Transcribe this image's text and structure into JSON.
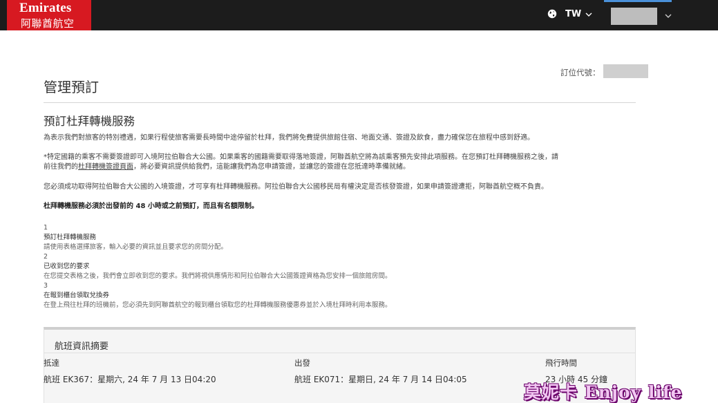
{
  "header": {
    "logo_en": "Emirates",
    "logo_zh": "阿聯酋航空",
    "region": "TW",
    "brand_color": "#d71921",
    "bar_color": "#1c1c1c",
    "accent_color": "#4a90d9"
  },
  "booking": {
    "ref_label": "訂位代號："
  },
  "page": {
    "title": "管理預訂",
    "section_title": "預訂杜拜轉機服務",
    "para1": "為表示我們對旅客的特別禮遇，如果行程使旅客需要長時間中途停留於杜拜，我們將免費提供旅館住宿、地面交通、簽證及飲食，盡力確保您在旅程中感到舒適。",
    "para2a": "*特定國籍的乘客不需要簽證即可入境阿拉伯聯合大公國。如果乘客的國籍需要取得落地簽證，阿聯酋航空將為該乘客預先安排此項服務。在您預訂杜拜轉機服務之後，請",
    "para2b_pre": "前往我們的",
    "para2b_link": "杜拜轉機簽證頁面",
    "para2b_post": "，將必要資訊提供給我們，這能讓我們為您申請簽證，並讓您的簽證在您抵達時準備就緒。",
    "para3": "您必須成功取得阿拉伯聯合大公國的入境簽證，才可享有杜拜轉機服務。阿拉伯聯合大公國移民局有權決定是否核發簽證，如果申請簽證遭拒，阿聯酋航空概不負責。",
    "para4": "杜拜轉機服務必須於出發前的 48 小時或之前預訂，而且有名額限制。"
  },
  "steps": [
    {
      "num": "1",
      "title": "預訂杜拜轉機服務",
      "desc": "請使用表格選擇旅客，輸入必要的資訊並且要求您的房間分配。"
    },
    {
      "num": "2",
      "title": "已收到您的要求",
      "desc": "在您提交表格之後，我們會立即收到您的要求。我們將視供應情形和阿拉伯聯合大公國簽證資格為您安排一個旅館房間。"
    },
    {
      "num": "3",
      "title": "在報到櫃台領取兌換券",
      "desc": "在登上飛往杜拜的班機前，您必須先到阿聯酋航空的報到櫃台領取您的杜拜轉機服務優惠券並於入境杜拜時利用本服務。"
    }
  ],
  "summary": {
    "title": "航班資訊摘要",
    "arrival_label": "抵達",
    "arrival_value": "航班 EK367：星期六, 24 年 7 月 13 日04:20",
    "departure_label": "出發",
    "departure_value": "航班 EK071：星期日, 24 年 7 月 14 日04:05",
    "flight_time_label": "飛行時間",
    "flight_time_value": "23 小時 45 分鐘"
  },
  "watermark": "莫妮卡 Enjoy life"
}
